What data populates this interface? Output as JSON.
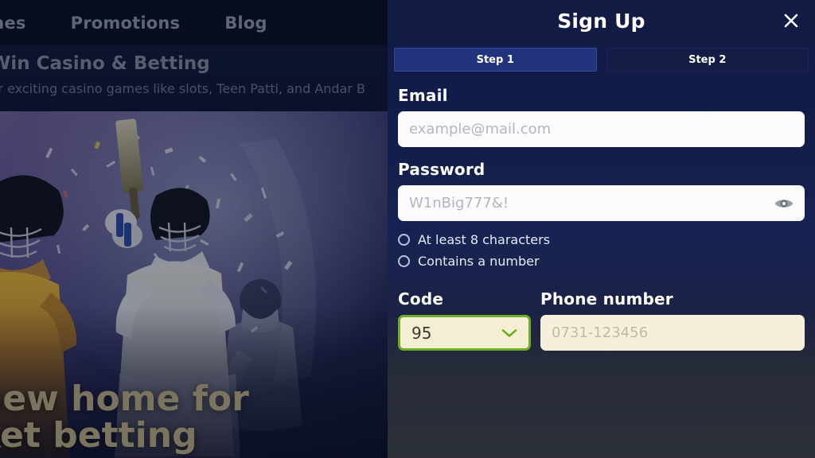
{
  "site": {
    "nav": [
      {
        "label": "ames",
        "name": "nav-games"
      },
      {
        "label": "Promotions",
        "name": "nav-promotions"
      },
      {
        "label": "Blog",
        "name": "nav-blog"
      }
    ],
    "page_title": "Win Casino & Betting",
    "page_subtitle": "for exciting casino games like slots, Teen Patti, and Andar B",
    "hero_line1": "new home for",
    "hero_line2": "ket betting",
    "hero_text_color": "#c9b98a"
  },
  "modal": {
    "title": "Sign Up",
    "close_icon": "close-icon",
    "steps": [
      {
        "label": "Step 1",
        "active": true
      },
      {
        "label": "Step 2",
        "active": false
      }
    ],
    "email": {
      "label": "Email",
      "placeholder": "example@mail.com",
      "value": ""
    },
    "password": {
      "label": "Password",
      "placeholder": "W1nBig777&!",
      "value": "",
      "toggle_icon": "eye-icon"
    },
    "password_rules": [
      {
        "text": "At least 8 characters",
        "met": false
      },
      {
        "text": "Contains a number",
        "met": false
      }
    ],
    "code": {
      "label": "Code",
      "value": "95",
      "chevron_icon": "chevron-down-icon",
      "border_color": "#6fae24",
      "background_color": "#f4eed5"
    },
    "phone": {
      "label": "Phone number",
      "placeholder": "0731-123456",
      "value": "",
      "background_color": "#f5efdc"
    },
    "colors": {
      "panel_top": "#111b44",
      "panel_bottom": "#2b3038",
      "step_active": "#22337e",
      "step_inactive": "#141d46",
      "accent_green": "#6fae24"
    }
  }
}
